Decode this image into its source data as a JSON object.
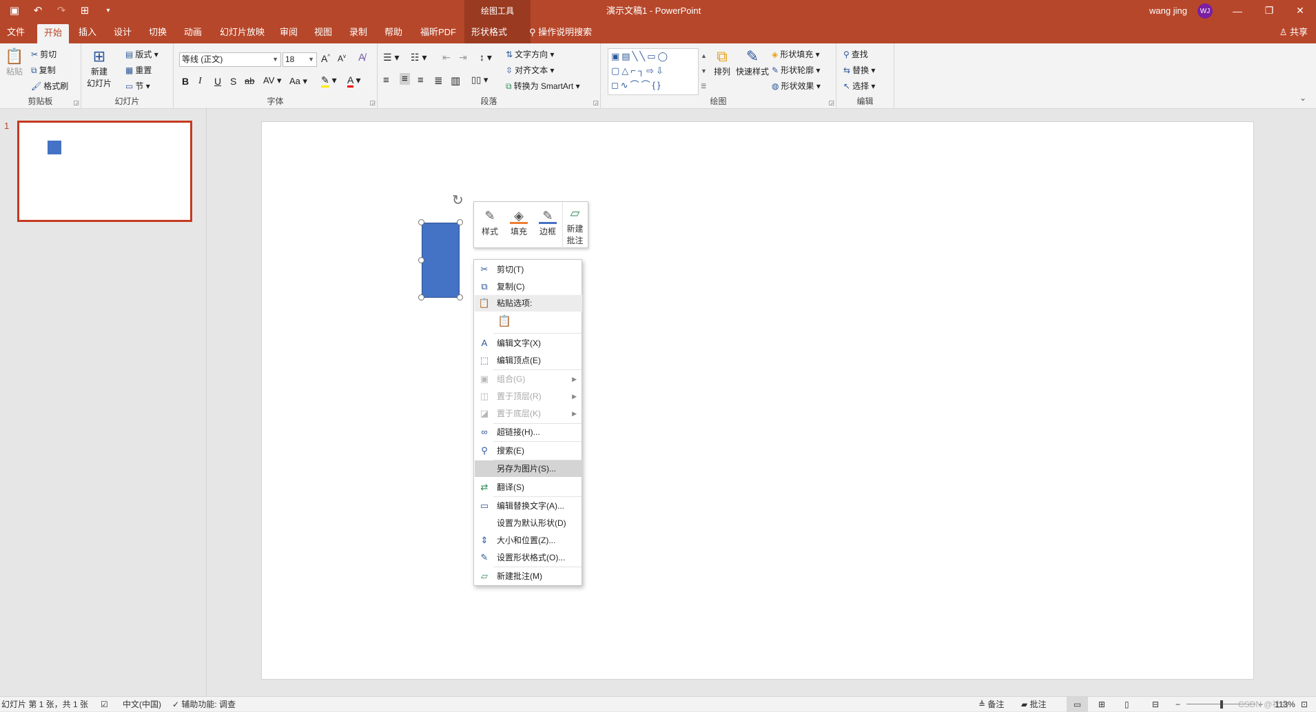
{
  "colors": {
    "accent": "#b7472a",
    "context_tab": "#9a3a21",
    "shape_fill": "#4472c4",
    "slide_border": "#c5391f"
  },
  "titlebar": {
    "context_group": "绘图工具",
    "doc_title": "演示文稿1  -  PowerPoint",
    "user_name": "wang jing",
    "avatar_initials": "WJ",
    "quick_access": [
      "save-icon",
      "undo-icon",
      "redo-icon",
      "present-icon",
      "customize-icon"
    ]
  },
  "tabs": [
    "文件",
    "开始",
    "插入",
    "设计",
    "切换",
    "动画",
    "幻灯片放映",
    "审阅",
    "视图",
    "录制",
    "帮助",
    "福昕PDF",
    "形状格式"
  ],
  "active_tab": "开始",
  "tell_me": "操作说明搜索",
  "share": "共享",
  "ribbon": {
    "clipboard": {
      "label": "剪贴板",
      "paste": "粘贴",
      "cut": "剪切",
      "copy": "复制",
      "format_painter": "格式刷"
    },
    "slides": {
      "label": "幻灯片",
      "new_slide_1": "新建",
      "new_slide_2": "幻灯片",
      "layout": "版式",
      "reset": "重置",
      "section": "节"
    },
    "font": {
      "label": "字体",
      "font_name": "等线 (正文)",
      "font_size": "18"
    },
    "paragraph": {
      "label": "段落",
      "text_direction": "文字方向",
      "align_text": "对齐文本",
      "smartart": "转换为 SmartArt"
    },
    "drawing": {
      "label": "绘图",
      "arrange": "排列",
      "quick_styles": "快速样式",
      "shape_fill": "形状填充",
      "shape_outline": "形状轮廓",
      "shape_effects": "形状效果"
    },
    "editing": {
      "label": "编辑",
      "find": "查找",
      "replace": "替换",
      "select": "选择"
    }
  },
  "slide_number": "1",
  "mini_toolbar": [
    {
      "name": "style",
      "label": "样式"
    },
    {
      "name": "fill",
      "label": "填充"
    },
    {
      "name": "outline",
      "label": "边框"
    },
    {
      "name": "new-comment",
      "label_1": "新建",
      "label_2": "批注"
    }
  ],
  "context_menu": [
    {
      "label": "剪切(T)",
      "icon": "✂",
      "state": "enabled"
    },
    {
      "label": "复制(C)",
      "icon": "⧉",
      "state": "enabled"
    },
    {
      "label": "粘贴选项:",
      "icon": "📋",
      "state": "header"
    },
    {
      "label": "",
      "icon": "📋",
      "state": "paste-option"
    },
    {
      "label": "编辑文字(X)",
      "icon": "A",
      "state": "enabled"
    },
    {
      "label": "编辑顶点(E)",
      "icon": "⬚",
      "state": "enabled"
    },
    {
      "label": "组合(G)",
      "icon": "▣",
      "state": "disabled",
      "submenu": true
    },
    {
      "label": "置于顶层(R)",
      "icon": "◫",
      "state": "disabled",
      "submenu": true
    },
    {
      "label": "置于底层(K)",
      "icon": "◪",
      "state": "disabled",
      "submenu": true
    },
    {
      "label": "超链接(H)...",
      "icon": "∞",
      "state": "enabled"
    },
    {
      "label": "搜索(E)",
      "icon": "⚲",
      "state": "enabled"
    },
    {
      "label": "另存为图片(S)...",
      "icon": "",
      "state": "highlighted"
    },
    {
      "label": "翻译(S)",
      "icon": "⇄",
      "state": "enabled"
    },
    {
      "label": "编辑替换文字(A)...",
      "icon": "▭",
      "state": "enabled"
    },
    {
      "label": "设置为默认形状(D)",
      "icon": "",
      "state": "enabled"
    },
    {
      "label": "大小和位置(Z)...",
      "icon": "⇕",
      "state": "enabled"
    },
    {
      "label": "设置形状格式(O)...",
      "icon": "✎",
      "state": "enabled"
    },
    {
      "label": "新建批注(M)",
      "icon": "▱",
      "state": "enabled"
    }
  ],
  "status": {
    "slide_info": "幻灯片 第 1 张，共 1 张",
    "language": "中文(中国)",
    "accessibility": "辅助功能: 调查",
    "notes": "备注",
    "comments": "批注",
    "zoom": "113%",
    "watermark": "CSDN @社会"
  }
}
